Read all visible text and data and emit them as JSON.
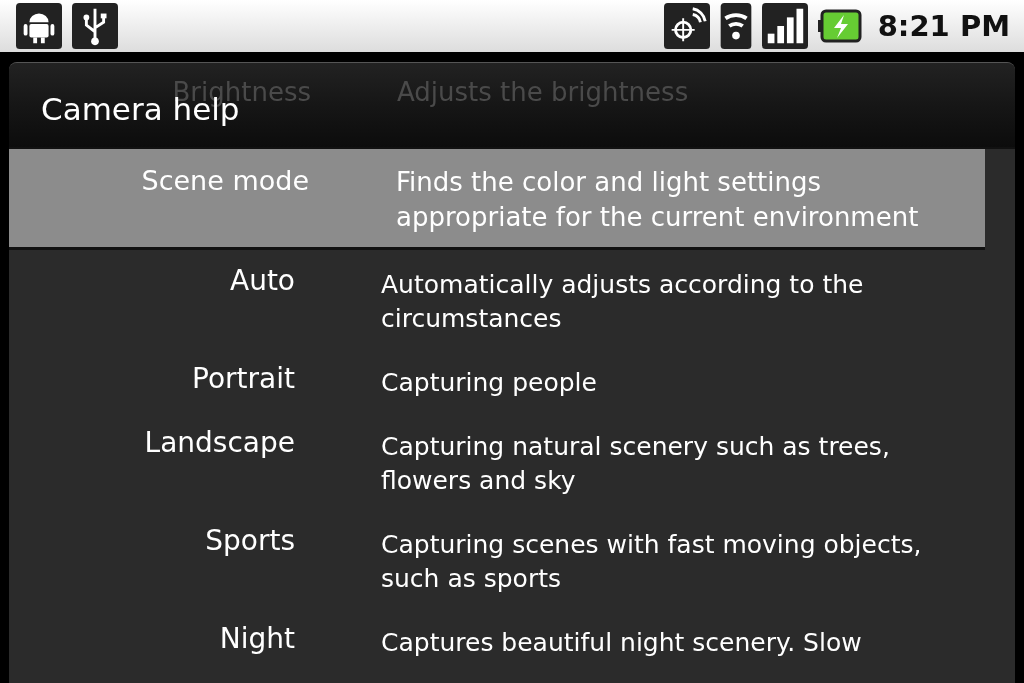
{
  "status_bar": {
    "time": "8:21 PM"
  },
  "dialog": {
    "title": "Camera help",
    "scrolled_row": {
      "label": "Brightness",
      "description": "Adjusts the brightness"
    },
    "section": {
      "label": "Scene mode",
      "description": "Finds the color and light settings appropriate for the current environment",
      "selected": true
    },
    "items": [
      {
        "label": "Auto",
        "description": "Automatically adjusts according to the circumstances"
      },
      {
        "label": "Portrait",
        "description": "Capturing people"
      },
      {
        "label": "Landscape",
        "description": "Capturing natural scenery such as trees, flowers and sky"
      },
      {
        "label": "Sports",
        "description": "Capturing scenes with fast moving objects, such as sports"
      },
      {
        "label": "Night",
        "description": "Captures beautiful night scenery. Slow"
      }
    ]
  }
}
